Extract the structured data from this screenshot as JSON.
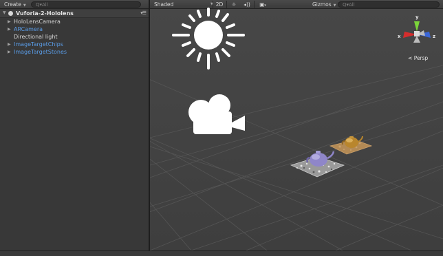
{
  "hierarchy": {
    "create_label": "Create",
    "search_placeholder": "Q▾All",
    "scene_name": "Vuforia-2-Hololens",
    "items": [
      {
        "label": "HoloLensCamera",
        "has_children": true,
        "color": "#d6d6d6"
      },
      {
        "label": "ARCamera",
        "has_children": true,
        "color": "#5a9ce6"
      },
      {
        "label": "Directional light",
        "has_children": false,
        "color": "#d6d6d6"
      },
      {
        "label": "ImageTargetChips",
        "has_children": true,
        "color": "#5a9ce6"
      },
      {
        "label": "ImageTargetStones",
        "has_children": true,
        "color": "#5a9ce6"
      }
    ]
  },
  "scene": {
    "shading_mode": "Shaded",
    "mode_2d": "2D",
    "gizmos_label": "Gizmos",
    "search_placeholder": "Q▾All",
    "perspective_label": "Persp",
    "axes": {
      "x": "x",
      "y": "y",
      "z": "z"
    },
    "icons": [
      "sun-light-icon",
      "light-toggle-icon",
      "audio-toggle-icon",
      "effects-dropdown-icon",
      "camera-gizmo-icon"
    ]
  }
}
